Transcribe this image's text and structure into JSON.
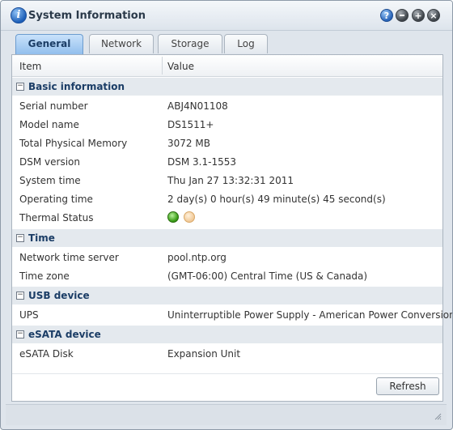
{
  "window": {
    "title": "System Information"
  },
  "titlebar_buttons": {
    "help_label": "?",
    "minimize_label": "",
    "maximize_label": "+",
    "close_label": "×"
  },
  "tabs": [
    {
      "label": "General",
      "active": true
    },
    {
      "label": "Network",
      "active": false
    },
    {
      "label": "Storage",
      "active": false
    },
    {
      "label": "Log",
      "active": false
    }
  ],
  "grid": {
    "columns": [
      "Item",
      "Value"
    ],
    "groups": [
      {
        "title": "Basic information",
        "rows": [
          {
            "item": "Serial number",
            "value": "ABJ4N01108"
          },
          {
            "item": "Model name",
            "value": "DS1511+"
          },
          {
            "item": "Total Physical Memory",
            "value": "3072 MB"
          },
          {
            "item": "DSM version",
            "value": "DSM 3.1-1553"
          },
          {
            "item": "System time",
            "value": "Thu Jan 27 13:32:31 2011"
          },
          {
            "item": "Operating time",
            "value": "2 day(s) 0 hour(s) 49 minute(s) 45 second(s)"
          },
          {
            "item": "Thermal Status",
            "value": ""
          }
        ]
      },
      {
        "title": "Time",
        "rows": [
          {
            "item": "Network time server",
            "value": "pool.ntp.org"
          },
          {
            "item": "Time zone",
            "value": "(GMT-06:00) Central Time (US & Canada)"
          }
        ]
      },
      {
        "title": "USB device",
        "rows": [
          {
            "item": "UPS",
            "value": "Uninterruptible Power Supply - American Power Conversion"
          }
        ]
      },
      {
        "title": "eSATA device",
        "rows": [
          {
            "item": "eSATA Disk",
            "value": "Expansion Unit"
          }
        ]
      }
    ]
  },
  "thermal_status": {
    "normal_color": "#3a9d17",
    "warning_color": "#f0c896"
  },
  "buttons": {
    "refresh": "Refresh"
  },
  "icons": {
    "title": "info-icon",
    "help": "help-icon",
    "minimize": "minimize-icon",
    "maximize": "maximize-icon",
    "close": "close-icon",
    "grip": "resize-grip-icon"
  },
  "theme": {
    "accent": "#8fbdec",
    "group_label_color": "#1b3d66"
  }
}
